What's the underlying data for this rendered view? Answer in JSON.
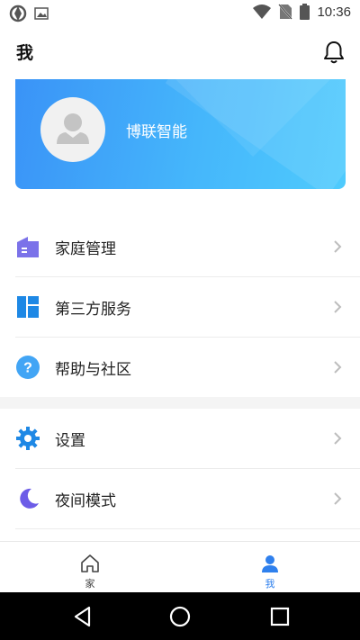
{
  "status_bar": {
    "time": "10:36",
    "left_icons": [
      "sync-app-icon",
      "image-notification-icon"
    ],
    "right_icons": [
      "wifi-icon",
      "no-sim-icon",
      "battery-icon"
    ]
  },
  "header": {
    "title": "我",
    "bell_icon": "bell-icon"
  },
  "profile": {
    "username": "博联智能",
    "avatar_icon": "avatar-placeholder-icon",
    "gradient_start": "#3a93f7",
    "gradient_end": "#4fcbfd"
  },
  "menu": {
    "items": [
      {
        "label": "家庭管理",
        "icon": "home-building-icon",
        "icon_color": "#7b72e9"
      },
      {
        "label": "第三方服务",
        "icon": "dashboard-tiles-icon",
        "icon_color": "#1e88e5"
      },
      {
        "label": "帮助与社区",
        "icon": "help-question-icon",
        "icon_color": "#42a5f5"
      },
      {
        "label": "设置",
        "icon": "settings-gear-icon",
        "icon_color": "#1e88e5"
      },
      {
        "label": "夜间模式",
        "icon": "moon-icon",
        "icon_color": "#6c5ce7"
      }
    ]
  },
  "tabs": [
    {
      "label": "家",
      "icon": "home-icon",
      "active": false,
      "color": "#444444"
    },
    {
      "label": "我",
      "icon": "person-icon",
      "active": true,
      "color": "#2f80ed"
    }
  ],
  "nav_bar": {
    "buttons": [
      "back-triangle-icon",
      "home-circle-icon",
      "recents-square-icon"
    ]
  }
}
